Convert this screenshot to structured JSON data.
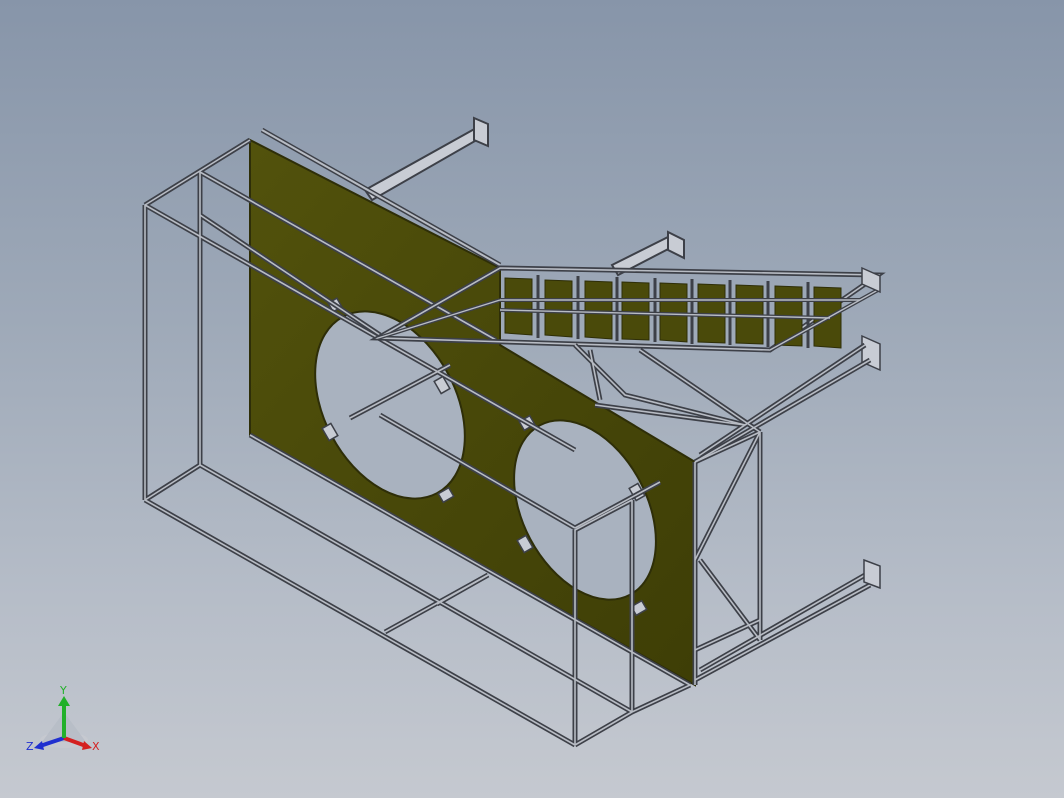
{
  "viewport": {
    "background_top": "#8795a9",
    "background_bottom": "#c5c9d0"
  },
  "model": {
    "frame_color": "#3d4048",
    "frame_highlight": "#b8bcc4",
    "plate_color": "#4a4a0a",
    "plate_edge": "#2e2e08",
    "hole_fill": "#a9b2bf"
  },
  "triad": {
    "y_label": "Y",
    "z_label": "Z",
    "x_label": "X",
    "y_color": "#22b02a",
    "x_color": "#d42020",
    "z_color": "#2030d0"
  }
}
